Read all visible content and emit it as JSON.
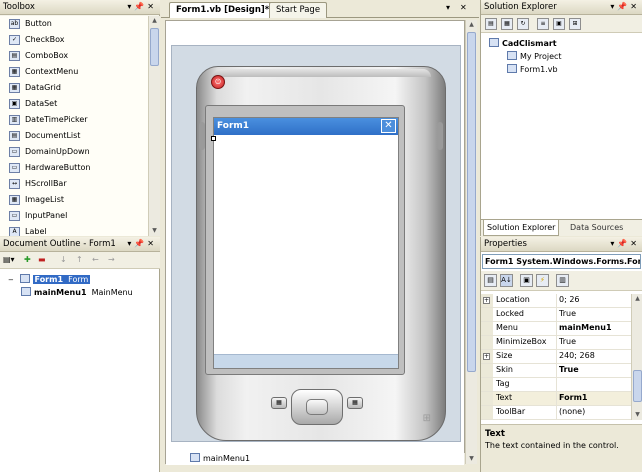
{
  "colors": {
    "accent": "#316ac5",
    "panel": "#ece9d8",
    "form_titlebar": "#2f6fc7"
  },
  "toolbox": {
    "title": "Toolbox",
    "items": [
      {
        "label": "Button",
        "icon": "ab"
      },
      {
        "label": "CheckBox",
        "icon": "✓"
      },
      {
        "label": "ComboBox",
        "icon": "▤"
      },
      {
        "label": "ContextMenu",
        "icon": "▦"
      },
      {
        "label": "DataGrid",
        "icon": "▦"
      },
      {
        "label": "DataSet",
        "icon": "▣"
      },
      {
        "label": "DateTimePicker",
        "icon": "▥"
      },
      {
        "label": "DocumentList",
        "icon": "▤"
      },
      {
        "label": "DomainUpDown",
        "icon": "▭"
      },
      {
        "label": "HardwareButton",
        "icon": "▭"
      },
      {
        "label": "HScrollBar",
        "icon": "↔"
      },
      {
        "label": "ImageList",
        "icon": "▦"
      },
      {
        "label": "InputPanel",
        "icon": "▭"
      },
      {
        "label": "Label",
        "icon": "A"
      }
    ]
  },
  "doc_outline": {
    "title": "Document Outline - Form1",
    "nodes": [
      {
        "name": "Form1",
        "type": "Form"
      },
      {
        "name": "mainMenu1",
        "type": "MainMenu"
      }
    ]
  },
  "designer": {
    "tabs": [
      {
        "label": "Form1.vb [Design]*"
      },
      {
        "label": "Start Page"
      }
    ],
    "form_title": "Form1",
    "form_close": "✕",
    "tray_component": "mainMenu1"
  },
  "solution_explorer": {
    "title": "Solution Explorer",
    "project": "CadClismart",
    "children": [
      "My Project",
      "Form1.vb"
    ],
    "bottom_tabs": [
      "Solution Explorer",
      "Data Sources"
    ]
  },
  "properties": {
    "title": "Properties",
    "object": "Form1  System.Windows.Forms.Forr",
    "rows": [
      {
        "name": "Location",
        "value": "0; 26",
        "expand": true,
        "bold": false
      },
      {
        "name": "Locked",
        "value": "True",
        "expand": false,
        "bold": false
      },
      {
        "name": "Menu",
        "value": "mainMenu1",
        "expand": false,
        "bold": true
      },
      {
        "name": "MinimizeBox",
        "value": "True",
        "expand": false,
        "bold": false
      },
      {
        "name": "Size",
        "value": "240; 268",
        "expand": true,
        "bold": false
      },
      {
        "name": "Skin",
        "value": "True",
        "expand": false,
        "bold": true
      },
      {
        "name": "Tag",
        "value": "",
        "expand": false,
        "bold": false
      },
      {
        "name": "Text",
        "value": "Form1",
        "expand": false,
        "bold": true
      },
      {
        "name": "ToolBar",
        "value": "(none)",
        "expand": false,
        "bold": false
      }
    ],
    "desc_title": "Text",
    "desc_text": "The text contained in the control."
  }
}
